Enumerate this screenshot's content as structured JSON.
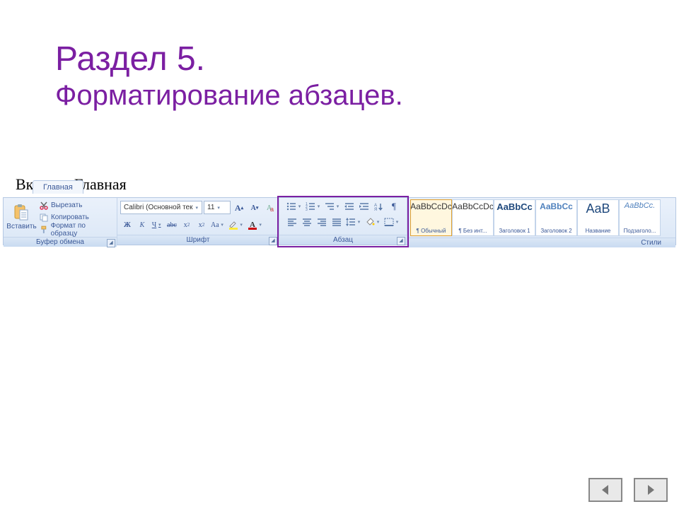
{
  "title": "Раздел 5.",
  "subtitle": "Форматирование абзацев.",
  "tab_label": "Вкладка Главная",
  "ribbon_tab": "Главная",
  "clipboard": {
    "paste": "Вставить",
    "cut": "Вырезать",
    "copy": "Копировать",
    "format_painter": "Формат по образцу",
    "label": "Буфер обмена"
  },
  "font": {
    "name": "Calibri (Основной тек",
    "size": "11",
    "label": "Шрифт"
  },
  "paragraph": {
    "label": "Абзац"
  },
  "styles": {
    "label": "Стили",
    "items": [
      {
        "sample": "AaBbCcDc",
        "name": "¶ Обычный",
        "cls": ""
      },
      {
        "sample": "AaBbCcDc",
        "name": "¶ Без инт...",
        "cls": ""
      },
      {
        "sample": "AaBbCc",
        "name": "Заголовок 1",
        "cls": "h1"
      },
      {
        "sample": "AaBbCc",
        "name": "Заголовок 2",
        "cls": "h2"
      },
      {
        "sample": "AaB",
        "name": "Название",
        "cls": "title"
      },
      {
        "sample": "AaBbCc.",
        "name": "Подзаголо...",
        "cls": "sub"
      }
    ]
  }
}
